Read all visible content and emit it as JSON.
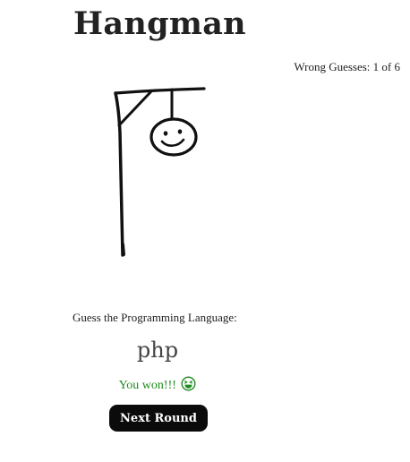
{
  "game": {
    "title": "Hangman",
    "wrong_guesses_text": "Wrong Guesses: 1 of 6",
    "wrong_guesses": 1,
    "max_wrong_guesses": 6
  },
  "puzzle": {
    "prompt": "Guess the Programming Language:",
    "word": "php"
  },
  "result": {
    "message": "You won!!!",
    "emoji_icon": "grinning-squint-face-icon"
  },
  "actions": {
    "next_round_label": "Next Round"
  },
  "colors": {
    "text": "#222222",
    "win_text": "#1f8a1f",
    "button_bg": "#0b0b0b",
    "button_text": "#ffffff"
  }
}
